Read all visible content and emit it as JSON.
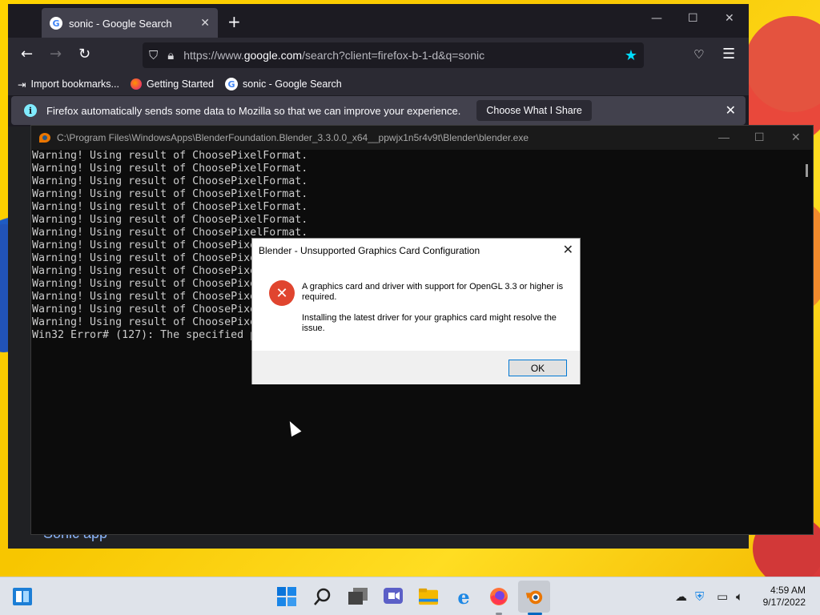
{
  "firefox": {
    "tab": {
      "title": "sonic - Google Search"
    },
    "url": {
      "prefix": "https://www.",
      "domain": "google.com",
      "rest": "/search?client=firefox-b-1-d&q=sonic"
    },
    "bookmarks": [
      "Import bookmarks...",
      "Getting Started",
      "sonic - Google Search"
    ],
    "infobar": {
      "message": "Firefox automatically sends some data to Mozilla so that we can improve your experience.",
      "button": "Choose What I Share"
    },
    "page": {
      "partial_link": "Sonic app"
    }
  },
  "console": {
    "title": "C:\\Program Files\\WindowsApps\\BlenderFoundation.Blender_3.3.0.0_x64__ppwjx1n5r4v9t\\Blender\\blender.exe",
    "lines": [
      "Warning! Using result of ChoosePixelFormat.",
      "Warning! Using result of ChoosePixelFormat.",
      "Warning! Using result of ChoosePixelFormat.",
      "Warning! Using result of ChoosePixelFormat.",
      "Warning! Using result of ChoosePixelFormat.",
      "Warning! Using result of ChoosePixelFormat.",
      "Warning! Using result of ChoosePixelFormat.",
      "Warning! Using result of ChoosePixe",
      "Warning! Using result of ChoosePixe",
      "Warning! Using result of ChoosePixe",
      "Warning! Using result of ChoosePixe",
      "Warning! Using result of ChoosePixe",
      "Warning! Using result of ChoosePixe",
      "Warning! Using result of ChoosePixe",
      "Win32 Error# (127): The specified p"
    ]
  },
  "dialog": {
    "title": "Blender - Unsupported Graphics Card Configuration",
    "message1": "A graphics card and driver with support for OpenGL 3.3 or higher is required.",
    "message2": "Installing the latest driver for your graphics card might resolve the issue.",
    "ok_label": "OK"
  },
  "taskbar": {
    "time": "4:59 AM",
    "date": "9/17/2022"
  }
}
